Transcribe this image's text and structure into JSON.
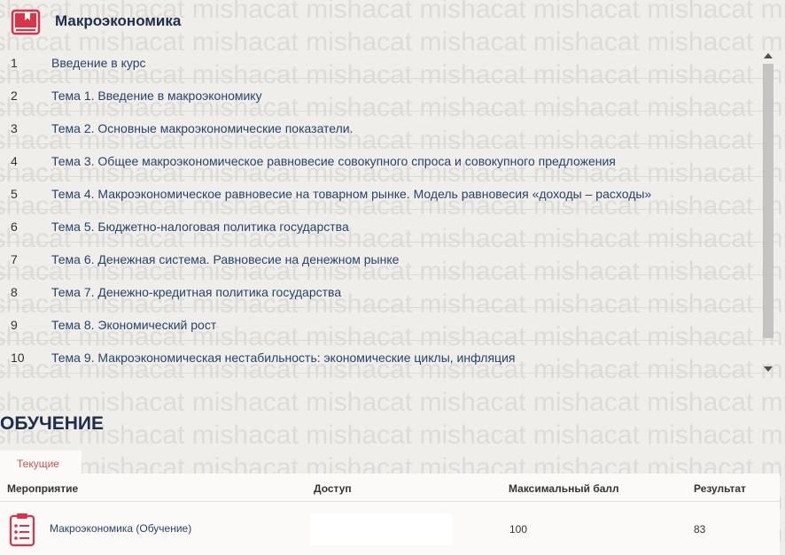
{
  "watermark": {
    "text": "mishacat"
  },
  "course": {
    "title": "Макроэкономика",
    "icon": "book-icon",
    "accent_color": "#d9344a"
  },
  "topics": [
    {
      "num": "1",
      "title": "Введение в курс"
    },
    {
      "num": "2",
      "title": "Тема 1. Введение в макроэкономику"
    },
    {
      "num": "3",
      "title": "Тема 2. Основные макроэкономические показатели."
    },
    {
      "num": "4",
      "title": "Тема 3. Общее макроэкономическое равновесие совокупного спроса и совокупного предложения"
    },
    {
      "num": "5",
      "title": "Тема 4. Макроэкономическое равновесие на товарном рынке. Модель равновесия «доходы – расходы»"
    },
    {
      "num": "6",
      "title": "Тема 5. Бюджетно-налоговая политика государства"
    },
    {
      "num": "7",
      "title": "Тема 6. Денежная система. Равновесие на денежном рынке"
    },
    {
      "num": "8",
      "title": "Тема 7. Денежно-кредитная политика государства"
    },
    {
      "num": "9",
      "title": "Тема 8. Экономический рост"
    },
    {
      "num": "10",
      "title": "Тема 9. Макроэкономическая нестабильность: экономические циклы, инфляция"
    }
  ],
  "learning": {
    "section_title": "ОБУЧЕНИЕ",
    "tab_current": "Текущие",
    "columns": {
      "event": "Мероприятие",
      "access": "Доступ",
      "max_score": "Максимальный балл",
      "result": "Результат"
    },
    "rows": [
      {
        "icon": "clipboard-icon",
        "event": "Макроэкономика (Обучение)",
        "access": "",
        "max_score": "100",
        "result": "83"
      }
    ]
  }
}
